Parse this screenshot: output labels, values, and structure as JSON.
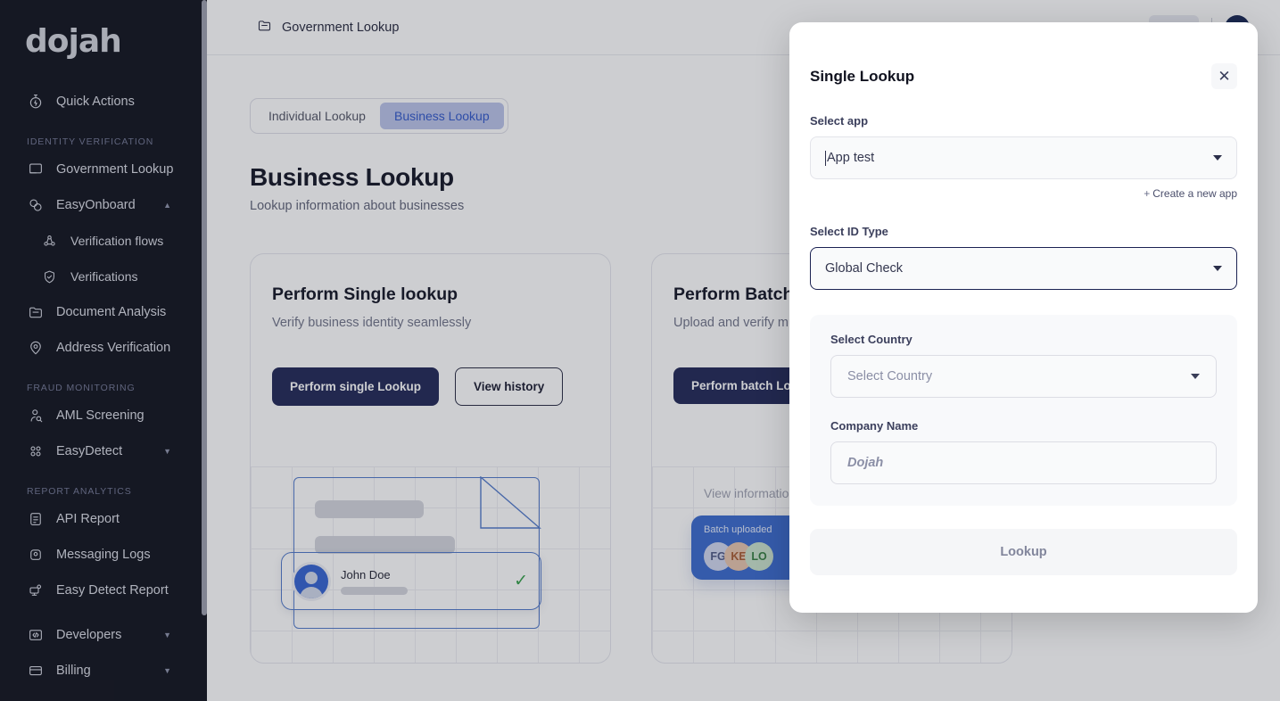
{
  "brand": {
    "logo_text": "dojah",
    "navy": "#0B1640",
    "sidebar_bg": "#0A0C17",
    "accent": "#2b53c8"
  },
  "sidebar": {
    "top_items": [
      {
        "label": "Quick Actions",
        "icon": "stopwatch-icon"
      }
    ],
    "sections": [
      {
        "label": "IDENTITY VERIFICATION",
        "items": [
          {
            "label": "Government Lookup",
            "icon": "monitor-icon",
            "caret": ""
          },
          {
            "label": "EasyOnboard",
            "icon": "onboard-icon",
            "caret": "▲"
          },
          {
            "label": "Verification flows",
            "icon": "flow-icon",
            "sub": true
          },
          {
            "label": "Verifications",
            "icon": "shield-check-icon",
            "sub": true
          },
          {
            "label": "Document Analysis",
            "icon": "folder-icon",
            "caret": ""
          },
          {
            "label": "Address Verification",
            "icon": "map-pin-icon",
            "caret": ""
          }
        ]
      },
      {
        "label": "FRAUD MONITORING",
        "items": [
          {
            "label": "AML Screening",
            "icon": "user-search-icon",
            "caret": ""
          },
          {
            "label": "EasyDetect",
            "icon": "grid-dots-icon",
            "caret": "▼"
          }
        ]
      },
      {
        "label": "REPORT ANALYTICS",
        "items": [
          {
            "label": "API Report",
            "icon": "document-report-icon",
            "caret": ""
          },
          {
            "label": "Messaging Logs",
            "icon": "inbox-icon",
            "caret": ""
          },
          {
            "label": "Easy Detect Report",
            "icon": "desktop-report-icon",
            "caret": ""
          }
        ]
      }
    ],
    "footer_items": [
      {
        "label": "Developers",
        "icon": "code-icon",
        "caret": "▼"
      },
      {
        "label": "Billing",
        "icon": "card-icon",
        "caret": "▼"
      }
    ]
  },
  "topbar": {
    "breadcrumb": "Government Lookup",
    "breadcrumb_icon": "folder-icon"
  },
  "page": {
    "tabs": [
      {
        "label": "Individual Lookup",
        "active": false
      },
      {
        "label": "Business Lookup",
        "active": true
      }
    ],
    "title": "Business Lookup",
    "subtitle": "Lookup information about businesses",
    "cards": [
      {
        "title": "Perform Single lookup",
        "subtitle": "Verify business identity seamlessly",
        "primary_label": "Perform single Lookup",
        "secondary_label": "View history",
        "illustration": {
          "person_name": "John Doe",
          "check_icon": "green-check-icon"
        }
      },
      {
        "title": "Perform Batch lookup",
        "subtitle": "Upload and verify multiple",
        "primary_label": "Perform batch Lookup",
        "illustration": {
          "caption": "View information",
          "badge_label": "Batch uploaded",
          "avatars": [
            {
              "initials": "FG",
              "bg": "#cfd6ee",
              "fg": "#4a5480"
            },
            {
              "initials": "KE",
              "bg": "#e6c3ab",
              "fg": "#a4562b"
            },
            {
              "initials": "LO",
              "bg": "#c9e2cb",
              "fg": "#2f7a3b"
            }
          ]
        }
      }
    ]
  },
  "modal": {
    "title": "Single Lookup",
    "close_icon": "close-icon",
    "select_app": {
      "label": "Select app",
      "value": "App test",
      "caret_icon": "chevron-down-icon"
    },
    "create_app_link": "Create a new app",
    "create_app_plus": "+",
    "select_id_type": {
      "label": "Select ID Type",
      "value": "Global Check",
      "caret_icon": "chevron-down-icon"
    },
    "select_country": {
      "label": "Select Country",
      "placeholder": "Select Country",
      "caret_icon": "chevron-down-icon"
    },
    "company_name": {
      "label": "Company Name",
      "placeholder": "Dojah",
      "value": ""
    },
    "submit_label": "Lookup"
  }
}
